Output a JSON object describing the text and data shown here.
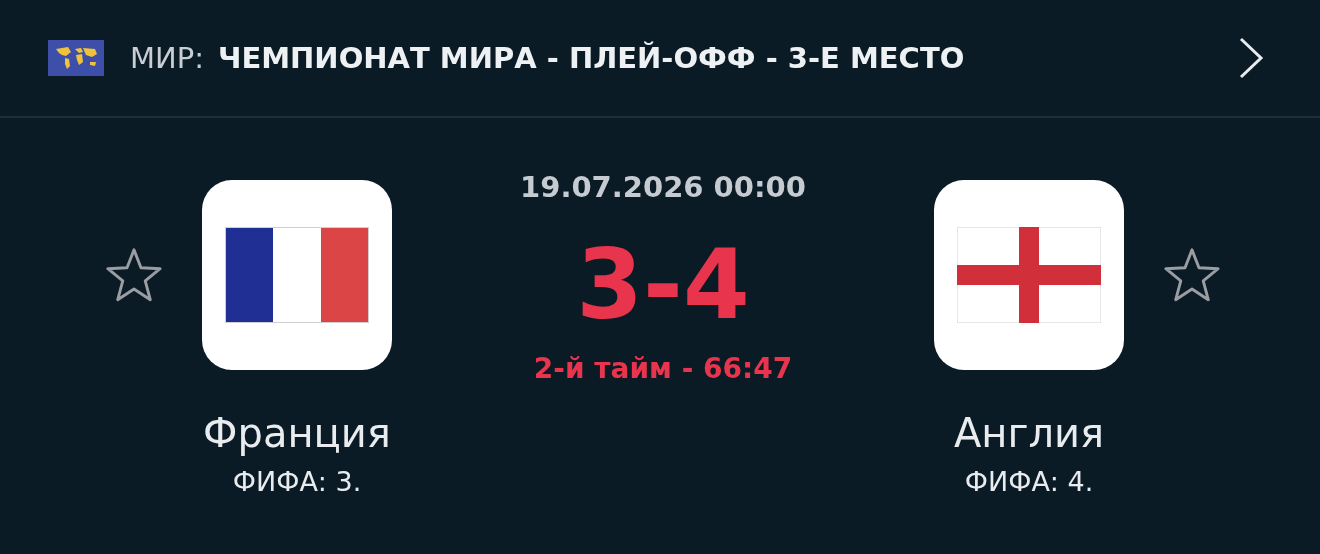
{
  "header": {
    "region": "МИР:",
    "competition": "ЧЕМПИОНАТ МИРА - ПЛЕЙ-ОФФ - 3-Е МЕСТО"
  },
  "match": {
    "datetime": "19.07.2026 00:00",
    "score": "3-4",
    "status": "2-й тайм - 66:47"
  },
  "teams": [
    {
      "name": "Франция",
      "rank": "ФИФА: 3.",
      "kind": "france"
    },
    {
      "name": "Англия",
      "rank": "ФИФА: 4.",
      "kind": "england"
    }
  ]
}
